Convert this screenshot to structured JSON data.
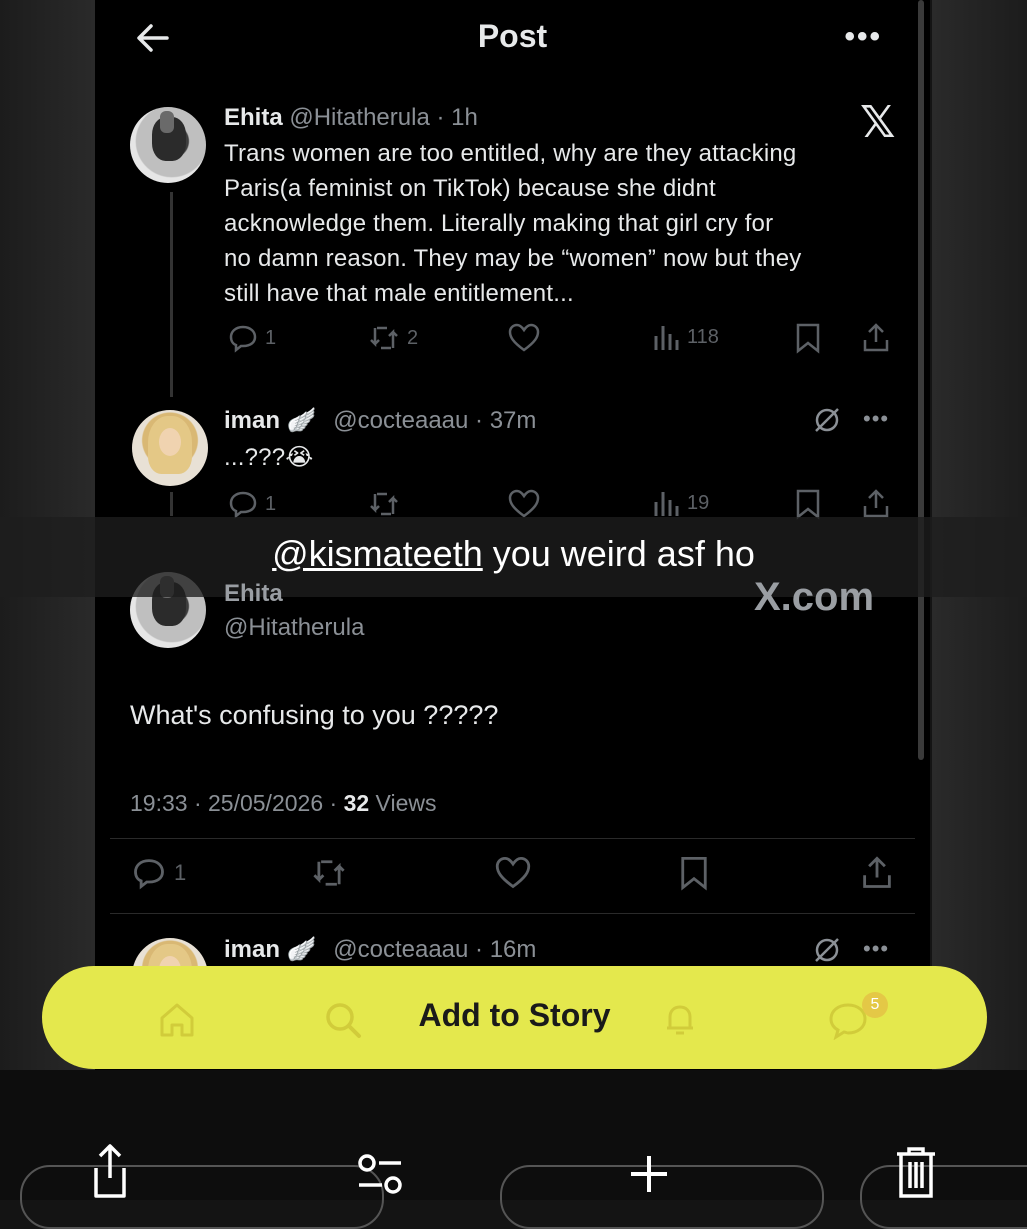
{
  "header": {
    "title": "Post"
  },
  "posts": [
    {
      "name": "Ehita",
      "handle": "@Hitatherula",
      "time": "· 1h",
      "text_lines": [
        "Trans women are too entitled, why are they attacking",
        "Paris(a feminist on TikTok) because she didnt",
        "acknowledge them. Literally making that girl cry for",
        "no damn reason. They may be “women” now but they",
        "still have that male entitlement..."
      ],
      "replies": "1",
      "reposts": "2",
      "views": "118"
    },
    {
      "name": "iman",
      "handle": "@cocteaaau",
      "time": "· 37m",
      "text": "...???",
      "replies": "1",
      "views": "19"
    }
  ],
  "caption": {
    "mention": "@kismateeth",
    "rest": " you weird asf ho"
  },
  "main_post": {
    "name": "Ehita",
    "handle": "@Hitatherula",
    "text": "What's confusing to you ?????",
    "time": "19:33 · 25/05/2026 ·",
    "views_count": "32",
    "views_label": "Views",
    "replies": "1"
  },
  "watermark": "X.com",
  "next_reply": {
    "name": "iman",
    "handle": "@cocteaaau",
    "time": "· 16m"
  },
  "story_bar": {
    "label": "Add to Story",
    "chat_badge": "5"
  },
  "colors": {
    "story_bar": "#e4e84d",
    "background": "#000000",
    "muted": "#8b9096"
  }
}
